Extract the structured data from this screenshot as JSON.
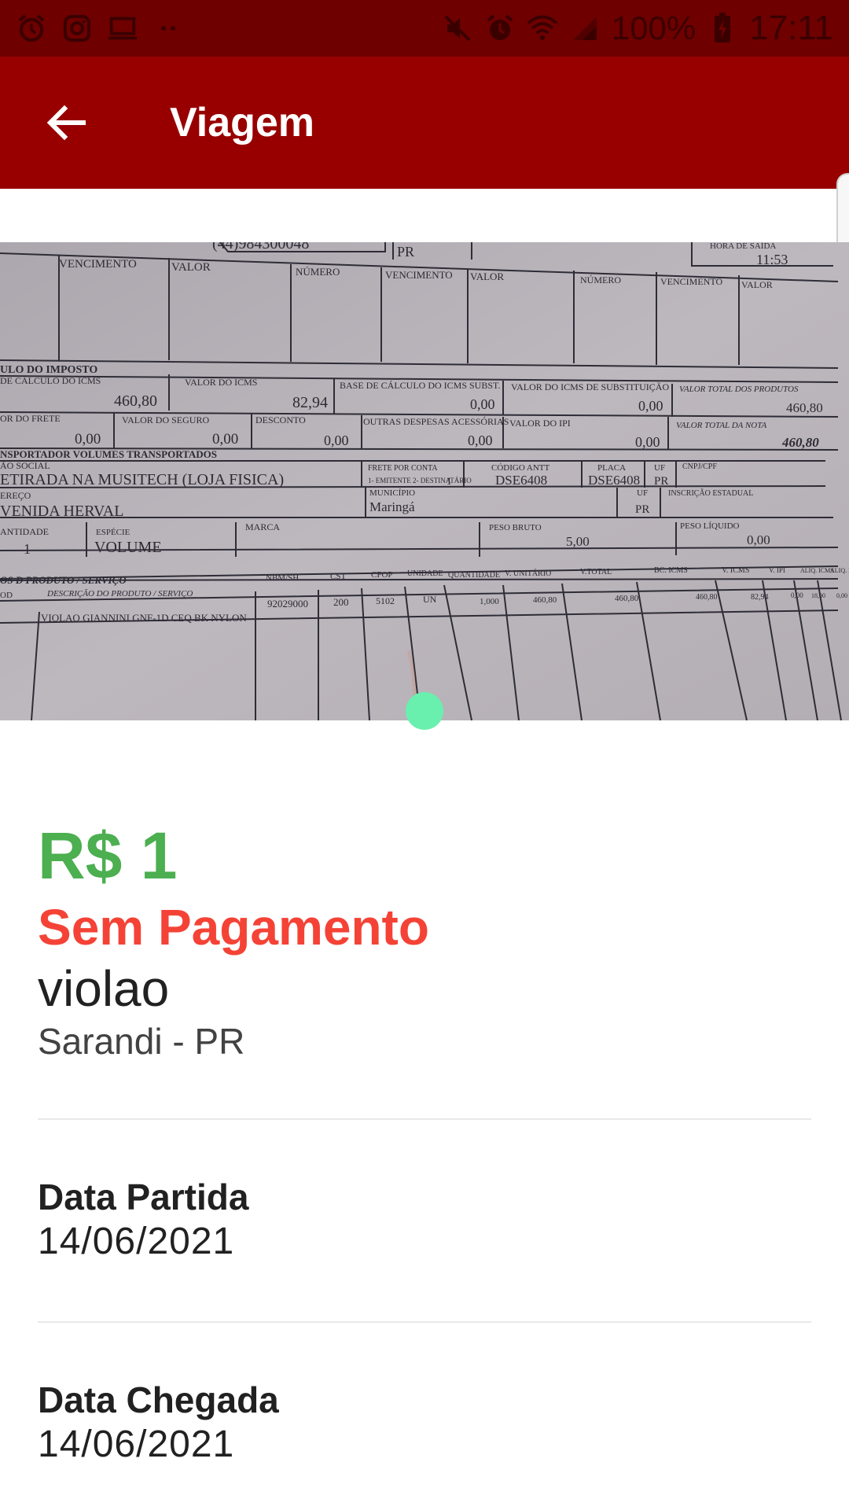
{
  "status_bar": {
    "battery": "100%",
    "time": "17:11"
  },
  "app_bar": {
    "title": "Viagem"
  },
  "photo": {
    "doc": {
      "hora_saida_label": "HORA DE SAÍDA",
      "hora_saida": "11:53",
      "phone": "(44)984300048",
      "uf_top": "PR",
      "vencimento": "VENCIMENTO",
      "valor": "VALOR",
      "numero": "NÚMERO",
      "section_imposto": "ULO DO IMPOSTO",
      "base_icms": "DE CÁLCULO DO ICMS",
      "base_icms_val": "460,80",
      "valor_icms": "VALOR DO ICMS",
      "valor_icms_val": "82,94",
      "base_subst": "BASE DE CÁLCULO DO ICMS SUBST.",
      "base_subst_val": "0,00",
      "valor_subst": "VALOR DO ICMS DE SUBSTITUIÇÃO",
      "valor_subst_val": "0,00",
      "total_produtos": "VALOR TOTAL DOS PRODUTOS",
      "total_produtos_val": "460,80",
      "frete": "OR DO FRETE",
      "frete_val": "0,00",
      "seguro": "VALOR DO SEGURO",
      "seguro_val": "0,00",
      "desconto": "DESCONTO",
      "desconto_val": "0,00",
      "outras": "OUTRAS DESPESAS ACESSÓRIAS",
      "outras_val": "0,00",
      "ipi": "VALOR DO IPI",
      "ipi_val": "0,00",
      "total_nota": "VALOR TOTAL DA NOTA",
      "total_nota_val": "460,80",
      "section_transp": "NSPORTADOR VOLUMES TRANSPORTADOS",
      "razao": "ÃO SOCIAL",
      "razao_val": "ETIRADA NA MUSITECH (LOJA FISICA)",
      "frete_conta": "FRETE POR CONTA",
      "frete_conta_opts": "1- EMITENTE 2- DESTINATÁRIO",
      "frete_conta_val": "1",
      "antt": "CÓDIGO ANTT",
      "antt_val": "DSE6408",
      "placa": "PLACA",
      "placa_val": "DSE6408",
      "uf": "UF",
      "uf_val": "PR",
      "cnpj": "CNPJ/CPF",
      "endereco": "EREÇO",
      "endereco_val": "VENIDA HERVAL",
      "municipio": "MUNICÍPIO",
      "municipio_val": "Maringá",
      "ie": "INSCRIÇÃO ESTADUAL",
      "quantidade": "ANTIDADE",
      "quantidade_val": "1",
      "especie": "ESPÉCIE",
      "especie_val": "VOLUME",
      "marca": "MARCA",
      "peso_bruto": "PESO BRUTO",
      "peso_bruto_val": "5,00",
      "peso_liquido": "PESO LÍQUIDO",
      "peso_liquido_val": "0,00",
      "section_produto": "OS D PRODUTO / SERVIÇO",
      "cod": "OD",
      "descricao": "DESCRIÇÃO DO PRODUTO / SERVIÇO",
      "ncm": "NBM/SH",
      "cst": "CST",
      "cfop": "CFOP",
      "unidade": "UNIDADE",
      "qtd": "QUANTIDADE",
      "v_unit": "V. UNITÁRIO",
      "v_total": "V.TOTAL",
      "bc_icms": "BC. ICMS",
      "v_icms": "V. ICMS",
      "v_ipi": "V. IPI",
      "aliq_icms": "ALIQ. ICMS",
      "aliq_ipi": "ALIQ. IPI",
      "item_desc": "VIOLAO GIANNINI GNF-1D CEQ BK NYLON",
      "item_ncm": "92029000",
      "item_cst": "200",
      "item_cfop": "5102",
      "item_un": "UN",
      "item_qtd": "1,000",
      "item_vunit": "460,80",
      "item_vtotal": "460,80",
      "item_bc": "460,80",
      "item_icms": "82,94",
      "item_ipi": "0,00",
      "item_aliq": "18,00",
      "item_aliq_ipi": "0,00"
    }
  },
  "details": {
    "price": "R$ 1",
    "payment_status": "Sem Pagamento",
    "product": "violao",
    "location": "Sarandi - PR",
    "departure_label": "Data Partida",
    "departure_date": "14/06/2021",
    "arrival_label": "Data Chegada",
    "arrival_date": "14/06/2021"
  },
  "colors": {
    "status_bar": "#6e0000",
    "app_bar": "#980000",
    "price": "#4caf50",
    "payment": "#f44336",
    "page_dot": "#69f0ae"
  }
}
